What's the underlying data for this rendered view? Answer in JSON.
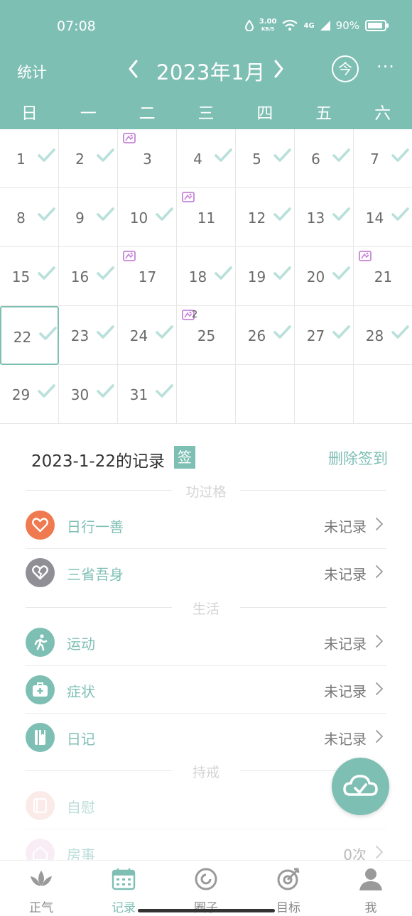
{
  "status_bar": {
    "time": "07:08",
    "speed": "3.00",
    "speed_unit": "KB/S",
    "network": "4G",
    "battery": "90%",
    "battery_level": 0.9
  },
  "header": {
    "stats_label": "统计",
    "title": "2023年1月",
    "today_label": "今",
    "more": "···"
  },
  "weekdays": [
    "日",
    "一",
    "二",
    "三",
    "四",
    "五",
    "六"
  ],
  "calendar": {
    "selected_day": 22,
    "days": [
      {
        "d": "1",
        "c": true
      },
      {
        "d": "2",
        "c": true
      },
      {
        "d": "3",
        "c": false,
        "m": true
      },
      {
        "d": "4",
        "c": true
      },
      {
        "d": "5",
        "c": true
      },
      {
        "d": "6",
        "c": true
      },
      {
        "d": "7",
        "c": true
      },
      {
        "d": "8",
        "c": true
      },
      {
        "d": "9",
        "c": true
      },
      {
        "d": "10",
        "c": true
      },
      {
        "d": "11",
        "c": false,
        "m": true
      },
      {
        "d": "12",
        "c": true
      },
      {
        "d": "13",
        "c": true
      },
      {
        "d": "14",
        "c": true
      },
      {
        "d": "15",
        "c": true
      },
      {
        "d": "16",
        "c": true
      },
      {
        "d": "17",
        "c": false,
        "m": true
      },
      {
        "d": "18",
        "c": true
      },
      {
        "d": "19",
        "c": true
      },
      {
        "d": "20",
        "c": true
      },
      {
        "d": "21",
        "c": false,
        "m": true
      },
      {
        "d": "22",
        "c": true
      },
      {
        "d": "23",
        "c": true
      },
      {
        "d": "24",
        "c": true
      },
      {
        "d": "25",
        "c": false,
        "m": true,
        "mc": "2"
      },
      {
        "d": "26",
        "c": true
      },
      {
        "d": "27",
        "c": true
      },
      {
        "d": "28",
        "c": true
      },
      {
        "d": "29",
        "c": true
      },
      {
        "d": "30",
        "c": true
      },
      {
        "d": "31",
        "c": true
      },
      {
        "d": "",
        "c": false
      },
      {
        "d": "",
        "c": false
      },
      {
        "d": "",
        "c": false
      },
      {
        "d": "",
        "c": false
      }
    ]
  },
  "record": {
    "title": "2023-1-22的记录",
    "signed_badge": "签",
    "delete_label": "删除签到",
    "sections": [
      {
        "name": "功过格",
        "items": [
          {
            "label": "日行一善",
            "value": "未记录",
            "icon": "heart-icon",
            "color": "#f07a4f"
          },
          {
            "label": "三省吾身",
            "value": "未记录",
            "icon": "broken-heart-icon",
            "color": "#8f8f95"
          }
        ]
      },
      {
        "name": "生活",
        "items": [
          {
            "label": "运动",
            "value": "未记录",
            "icon": "running-icon",
            "color": "#7ebfb4"
          },
          {
            "label": "症状",
            "value": "未记录",
            "icon": "medkit-icon",
            "color": "#7ebfb4"
          },
          {
            "label": "日记",
            "value": "未记录",
            "icon": "notebook-icon",
            "color": "#7ebfb4"
          }
        ]
      },
      {
        "name": "持戒",
        "items": [
          {
            "label": "自慰",
            "value": "",
            "icon": "tissue-icon",
            "color": "#f9d9d2"
          },
          {
            "label": "房事",
            "value": "0次",
            "icon": "house-icon",
            "color": "#f5dcec"
          }
        ]
      }
    ]
  },
  "tabs": [
    {
      "label": "正气",
      "icon": "lotus-icon",
      "active": false
    },
    {
      "label": "记录",
      "icon": "calendar-icon",
      "active": true
    },
    {
      "label": "圈子",
      "icon": "circle-icon",
      "active": false
    },
    {
      "label": "目标",
      "icon": "target-icon",
      "active": false
    },
    {
      "label": "我",
      "icon": "user-icon",
      "active": false
    }
  ],
  "colors": {
    "accent": "#7ebfb4",
    "marker": "#c784d8",
    "check": "#b9e0da"
  }
}
